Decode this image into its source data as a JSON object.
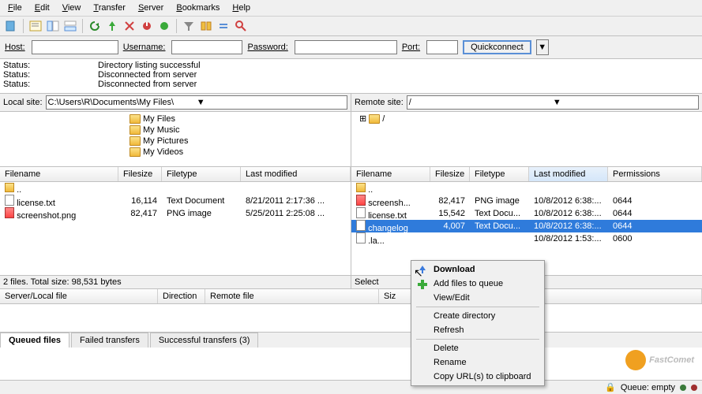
{
  "menu": [
    "File",
    "Edit",
    "View",
    "Transfer",
    "Server",
    "Bookmarks",
    "Help"
  ],
  "quickconnect": {
    "host_label": "Host:",
    "user_label": "Username:",
    "pass_label": "Password:",
    "port_label": "Port:",
    "button": "Quickconnect"
  },
  "log": [
    {
      "label": "Status:",
      "msg": "Directory listing successful"
    },
    {
      "label": "Status:",
      "msg": "Disconnected from server"
    },
    {
      "label": "Status:",
      "msg": "Disconnected from server"
    }
  ],
  "local": {
    "label": "Local site:",
    "path": "C:\\Users\\R\\Documents\\My Files\\",
    "tree": [
      "My Files",
      "My Music",
      "My Pictures",
      "My Videos"
    ],
    "cols": [
      "Filename",
      "Filesize",
      "Filetype",
      "Last modified"
    ],
    "up": "..",
    "rows": [
      {
        "name": "license.txt",
        "size": "16,114",
        "type": "Text Document",
        "mod": "8/21/2011 2:17:36 ...",
        "icon": "txt"
      },
      {
        "name": "screenshot.png",
        "size": "82,417",
        "type": "PNG image",
        "mod": "5/25/2011 2:25:08 ...",
        "icon": "png"
      }
    ],
    "status": "2 files. Total size: 98,531 bytes"
  },
  "remote": {
    "label": "Remote site:",
    "path": "/",
    "tree_root": "/",
    "cols": [
      "Filename",
      "Filesize",
      "Filetype",
      "Last modified",
      "Permissions"
    ],
    "up": "..",
    "rows": [
      {
        "name": "screensh...",
        "size": "82,417",
        "type": "PNG image",
        "mod": "10/8/2012 6:38:...",
        "perm": "0644",
        "icon": "png"
      },
      {
        "name": "license.txt",
        "size": "15,542",
        "type": "Text Docu...",
        "mod": "10/8/2012 6:38:...",
        "perm": "0644",
        "icon": "txt"
      },
      {
        "name": "changelog",
        "size": "4,007",
        "type": "Text Docu...",
        "mod": "10/8/2012 6:38:...",
        "perm": "0644",
        "icon": "txt",
        "sel": true
      },
      {
        "name": ".la...",
        "size": "",
        "type": "",
        "mod": "10/8/2012 1:53:...",
        "perm": "0600",
        "icon": "txt"
      }
    ],
    "status": "Select"
  },
  "queue": {
    "cols": [
      "Server/Local file",
      "Direction",
      "Remote file",
      "Siz"
    ],
    "tabs": [
      "Queued files",
      "Failed transfers",
      "Successful transfers (3)"
    ]
  },
  "context_menu": {
    "download": "Download",
    "add_queue": "Add files to queue",
    "view_edit": "View/Edit",
    "create_dir": "Create directory",
    "refresh": "Refresh",
    "delete": "Delete",
    "rename": "Rename",
    "copy_url": "Copy URL(s) to clipboard"
  },
  "footer": {
    "queue": "Queue: empty"
  },
  "watermark": "FastComet"
}
